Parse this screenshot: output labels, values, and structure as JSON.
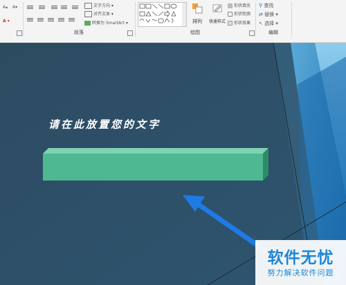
{
  "ribbon": {
    "paragraph": {
      "group_label": "段落",
      "text_direction": "文字方向",
      "align_text": "对齐文本",
      "convert_smartart": "转换为 SmartArt"
    },
    "drawing": {
      "group_label": "绘图",
      "arrange": "排列",
      "quick_styles": "快速样式",
      "shape_fill": "形状填充",
      "shape_outline": "形状轮廓",
      "shape_effects": "形状效果"
    },
    "editing": {
      "group_label": "编辑",
      "find": "查找",
      "replace": "替换",
      "select": "选择"
    }
  },
  "slide": {
    "title_placeholder": "请在此放置您的文字",
    "arrow_color": "#1e7be6",
    "box_front_color": "#4db892",
    "box_side_color": "#2e8a6a",
    "box_top_color": "#7fd3b4",
    "background_color": "#2d4d63"
  },
  "watermark": {
    "name": "软件无忧",
    "subtitle": "努力解决软件问题"
  }
}
